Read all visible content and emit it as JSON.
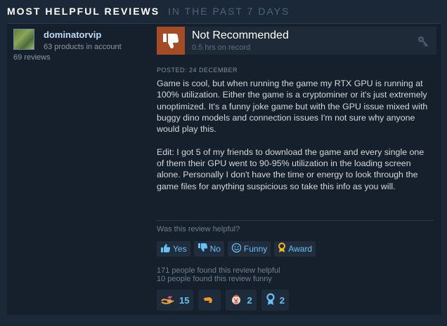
{
  "header": {
    "title": "MOST HELPFUL REVIEWS",
    "subtitle": "IN THE PAST 7 DAYS"
  },
  "reviewer": {
    "username": "dominatorvip",
    "products": "63 products in account",
    "reviews": "69 reviews"
  },
  "review": {
    "verdict": "Not Recommended",
    "hours": "0.5 hrs on record",
    "posted": "POSTED: 24 DECEMBER",
    "body": "Game is cool, but when running the game my RTX GPU is running at 100% utilization. Either the game is a cryptominer or it's just extremely unoptimized. It's a funny joke game but with the GPU issue mixed with buggy dino models and connection issues I'm not sure why anyone would play this.\n\nEdit: I got 5 of my friends to download the game and every single one of them their GPU went to 90-95% utilization in the loading screen alone. Personally I don't have the time or energy to look through the game files for anything suspicious so take this info as you will.",
    "helpful_question": "Was this review helpful?",
    "buttons": {
      "yes": "Yes",
      "no": "No",
      "funny": "Funny",
      "award": "Award"
    },
    "helpful_count": "171 people found this review helpful",
    "funny_count": "10 people found this review funny",
    "awards": [
      {
        "icon": "hand-heart-icon",
        "count": "15"
      },
      {
        "icon": "arm-icon",
        "count": ""
      },
      {
        "icon": "clown-face-icon",
        "count": "2"
      },
      {
        "icon": "medal-icon",
        "count": "2"
      }
    ]
  },
  "colors": {
    "background": "#1b2838",
    "card": "#16202d",
    "thumb_down_bg": "#a34c25",
    "link": "#67c1f5",
    "award_orange": "#f29624"
  }
}
